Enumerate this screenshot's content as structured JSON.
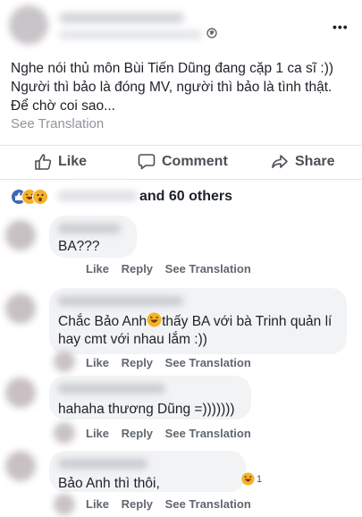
{
  "post": {
    "lines": [
      "Nghe nói thủ môn Bùi Tiến Dũng đang cặp 1 ca sĩ :))",
      "Người thì bảo là đóng MV, người thì bảo là tình thật.",
      "Để chờ coi sao..."
    ],
    "see_translation": "See Translation"
  },
  "actions": {
    "like": "Like",
    "comment": "Comment",
    "share": "Share"
  },
  "reactions": {
    "others_text": "and 60 others"
  },
  "comments": [
    {
      "text": "BA???",
      "like": "Like",
      "reply": "Reply",
      "see_translation": "See Translation"
    },
    {
      "text_line1_a": "Chắc Bảo Anh",
      "text_line1_b": "thấy BA với bà Trinh quản lí",
      "text_line2": "hay cmt với nhau lắm :))",
      "like": "Like",
      "reply": "Reply",
      "see_translation": "See Translation"
    },
    {
      "text": "hahaha thương Dũng =)))))))",
      "like": "Like",
      "reply": "Reply",
      "see_translation": "See Translation"
    },
    {
      "text": "Bảo Anh thì thôi,",
      "reaction_count": "1",
      "like": "Like",
      "reply": "Reply",
      "see_translation": "See Translation"
    }
  ],
  "icons": {
    "globe": "globe-icon",
    "more": "more-options-icon",
    "like": "thumbs-up-icon",
    "comment": "speech-bubble-icon",
    "share": "share-arrow-icon"
  },
  "colors": {
    "like_blue": "#4267b2",
    "haha_yellow": "#f7b125",
    "text": "#1d2129",
    "meta": "#606770"
  }
}
